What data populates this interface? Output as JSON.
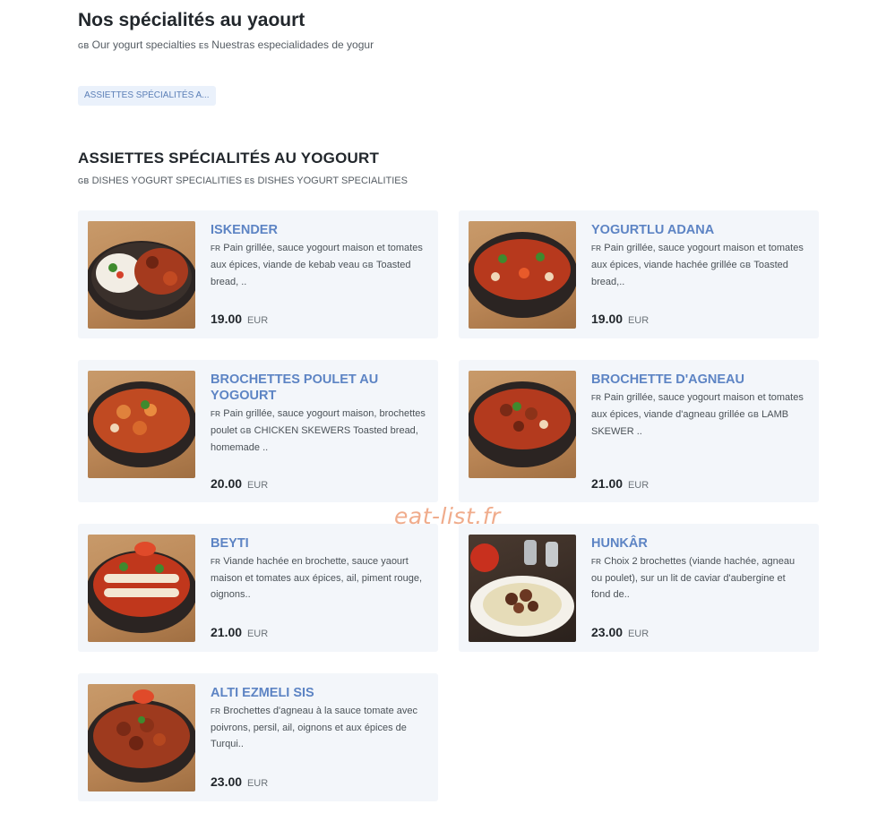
{
  "header": {
    "title": "Nos spécialités au yaourt",
    "subtitle": [
      {
        "lang": "GB",
        "text": "Our yogurt specialties"
      },
      {
        "lang": "ES",
        "text": "Nuestras especialidades de yogur"
      }
    ]
  },
  "category_chip": "ASSIETTES SPÉCIALITÉS A...",
  "category": {
    "title": "ASSIETTES SPÉCIALITÉS AU YOGOURT",
    "subtitle": [
      {
        "lang": "GB",
        "text": "DISHES YOGURT SPECIALITIES"
      },
      {
        "lang": "ES",
        "text": "DISHES YOGURT SPECIALITIES"
      }
    ]
  },
  "currency": "EUR",
  "items": [
    {
      "name": "ISKENDER",
      "lang_fr": "FR",
      "desc_fr": "Pain grillée, sauce yogourt maison et tomates aux épices, viande de kebab veau",
      "lang_gb": "GB",
      "desc_gb": "Toasted bread, ..",
      "price": "19.00",
      "image": "iskender-dish-icon"
    },
    {
      "name": "YOGURTLU ADANA",
      "lang_fr": "FR",
      "desc_fr": "Pain grillée, sauce yogourt maison et tomates aux épices, viande hachée grillée",
      "lang_gb": "GB",
      "desc_gb": "Toasted bread,..",
      "price": "19.00",
      "image": "adana-dish-icon"
    },
    {
      "name": "BROCHETTES POULET AU YOGOURT",
      "lang_fr": "FR",
      "desc_fr": "Pain grillée, sauce yogourt maison, brochettes poulet",
      "lang_gb": "GB",
      "desc_gb": "CHICKEN SKEWERS Toasted bread, homemade ..",
      "price": "20.00",
      "image": "chicken-skewers-dish-icon"
    },
    {
      "name": "BROCHETTE D'AGNEAU",
      "lang_fr": "FR",
      "desc_fr": "Pain grillée, sauce yogourt maison et tomates aux épices, viande d'agneau grillée",
      "lang_gb": "GB",
      "desc_gb": "LAMB SKEWER ..",
      "price": "21.00",
      "image": "lamb-skewer-dish-icon"
    },
    {
      "name": "BEYTI",
      "lang_fr": "FR",
      "desc_fr": "Viande hachée en brochette, sauce yaourt maison et tomates aux épices, ail, piment rouge, oignons..",
      "lang_gb": "",
      "desc_gb": "",
      "price": "21.00",
      "image": "beyti-dish-icon"
    },
    {
      "name": "HUNKÂR",
      "lang_fr": "FR",
      "desc_fr": "Choix 2 brochettes (viande hachée, agneau ou poulet), sur un lit de caviar d'aubergine et fond de..",
      "lang_gb": "",
      "desc_gb": "",
      "price": "23.00",
      "image": "hunkar-dish-icon"
    },
    {
      "name": "ALTI EZMELI SIS",
      "lang_fr": "FR",
      "desc_fr": "Brochettes d'agneau à la sauce tomate avec poivrons, persil, ail, oignons et aux épices de Turqui..",
      "lang_gb": "",
      "desc_gb": "",
      "price": "23.00",
      "image": "alti-ezmeli-dish-icon"
    }
  ],
  "watermark": "eat-list.fr"
}
